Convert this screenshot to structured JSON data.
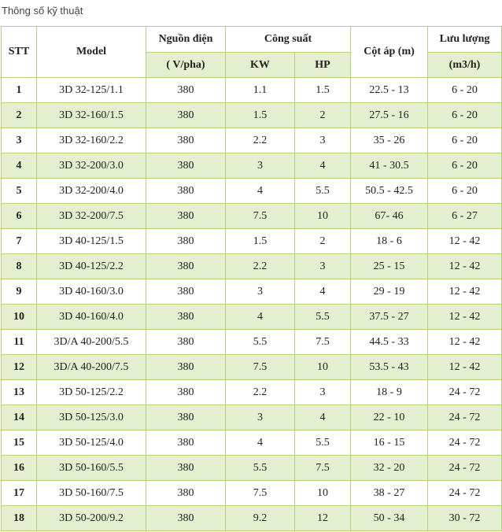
{
  "page_title": "Thông số kỹ thuật",
  "table": {
    "headers": {
      "stt": "STT",
      "model": "Model",
      "power_source": "Nguồn điện",
      "power_source_unit": "( V/pha)",
      "capacity": "Công suất",
      "kw": "KW",
      "hp": "HP",
      "head": "Cột áp (m)",
      "flow": "Lưu lượng",
      "flow_unit": "(m3/h)"
    },
    "rows": [
      {
        "stt": "1",
        "model": "3D 32-125/1.1",
        "voltage": "380",
        "kw": "1.1",
        "hp": "1.5",
        "head": "22.5 - 13",
        "flow": "6 - 20"
      },
      {
        "stt": "2",
        "model": "3D 32-160/1.5",
        "voltage": "380",
        "kw": "1.5",
        "hp": "2",
        "head": "27.5 - 16",
        "flow": "6 - 20"
      },
      {
        "stt": "3",
        "model": "3D 32-160/2.2",
        "voltage": "380",
        "kw": "2.2",
        "hp": "3",
        "head": "35 - 26",
        "flow": "6 - 20"
      },
      {
        "stt": "4",
        "model": "3D 32-200/3.0",
        "voltage": "380",
        "kw": "3",
        "hp": "4",
        "head": "41 - 30.5",
        "flow": "6 - 20"
      },
      {
        "stt": "5",
        "model": "3D 32-200/4.0",
        "voltage": "380",
        "kw": "4",
        "hp": "5.5",
        "head": "50.5 - 42.5",
        "flow": "6 - 20"
      },
      {
        "stt": "6",
        "model": "3D 32-200/7.5",
        "voltage": "380",
        "kw": "7.5",
        "hp": "10",
        "head": "67- 46",
        "flow": "6 - 27"
      },
      {
        "stt": "7",
        "model": "3D 40-125/1.5",
        "voltage": "380",
        "kw": "1.5",
        "hp": "2",
        "head": "18 - 6",
        "flow": "12 - 42"
      },
      {
        "stt": "8",
        "model": "3D 40-125/2.2",
        "voltage": "380",
        "kw": "2.2",
        "hp": "3",
        "head": "25 - 15",
        "flow": "12 - 42"
      },
      {
        "stt": "9",
        "model": "3D 40-160/3.0",
        "voltage": "380",
        "kw": "3",
        "hp": "4",
        "head": "29 - 19",
        "flow": "12 - 42"
      },
      {
        "stt": "10",
        "model": "3D 40-160/4.0",
        "voltage": "380",
        "kw": "4",
        "hp": "5.5",
        "head": "37.5 - 27",
        "flow": "12 - 42"
      },
      {
        "stt": "11",
        "model": "3D/A 40-200/5.5",
        "voltage": "380",
        "kw": "5.5",
        "hp": "7.5",
        "head": "44.5 - 33",
        "flow": "12 - 42"
      },
      {
        "stt": "12",
        "model": "3D/A 40-200/7.5",
        "voltage": "380",
        "kw": "7.5",
        "hp": "10",
        "head": "53.5 - 43",
        "flow": "12 - 42"
      },
      {
        "stt": "13",
        "model": "3D 50-125/2.2",
        "voltage": "380",
        "kw": "2.2",
        "hp": "3",
        "head": "18 - 9",
        "flow": "24 - 72"
      },
      {
        "stt": "14",
        "model": "3D 50-125/3.0",
        "voltage": "380",
        "kw": "3",
        "hp": "4",
        "head": "22 - 10",
        "flow": "24 - 72"
      },
      {
        "stt": "15",
        "model": "3D 50-125/4.0",
        "voltage": "380",
        "kw": "4",
        "hp": "5.5",
        "head": "16 - 15",
        "flow": "24 - 72"
      },
      {
        "stt": "16",
        "model": "3D 50-160/5.5",
        "voltage": "380",
        "kw": "5.5",
        "hp": "7.5",
        "head": "32 - 20",
        "flow": "24 - 72"
      },
      {
        "stt": "17",
        "model": "3D 50-160/7.5",
        "voltage": "380",
        "kw": "7.5",
        "hp": "10",
        "head": "38 - 27",
        "flow": "24 - 72"
      },
      {
        "stt": "18",
        "model": "3D 50-200/9.2",
        "voltage": "380",
        "kw": "9.2",
        "hp": "12",
        "head": "50 - 34",
        "flow": "30 - 72"
      }
    ]
  }
}
